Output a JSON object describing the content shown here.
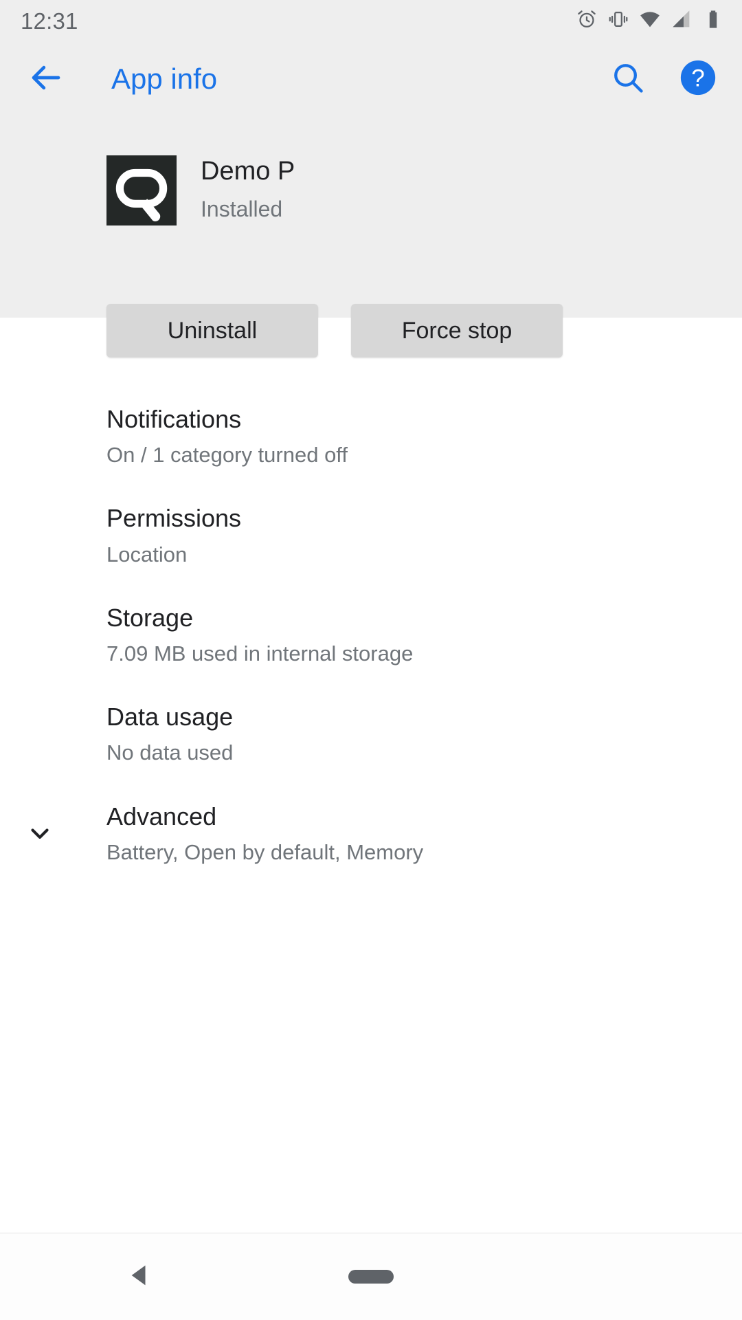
{
  "status_bar": {
    "time": "12:31",
    "icons": [
      "alarm-icon",
      "vibrate-icon",
      "wifi-icon",
      "cell-signal-icon",
      "battery-icon"
    ]
  },
  "app_bar": {
    "title": "App info",
    "back_icon": "arrow-back-icon",
    "search_icon": "search-icon",
    "help_icon": "help-icon",
    "accent_color": "#1a73e8"
  },
  "app_header": {
    "app_name": "Demo P",
    "install_state": "Installed",
    "icon_name": "demo-p-app-icon",
    "icon_background": "#242827",
    "icon_foreground": "#ffffff"
  },
  "actions": {
    "uninstall_label": "Uninstall",
    "force_stop_label": "Force stop",
    "button_color": "#d7d7d7"
  },
  "settings_rows": [
    {
      "name": "notifications",
      "title": "Notifications",
      "subtitle": "On / 1 category turned off",
      "leading_icon": ""
    },
    {
      "name": "permissions",
      "title": "Permissions",
      "subtitle": "Location",
      "leading_icon": ""
    },
    {
      "name": "storage",
      "title": "Storage",
      "subtitle": "7.09 MB used in internal storage",
      "leading_icon": ""
    },
    {
      "name": "data-usage",
      "title": "Data usage",
      "subtitle": "No data used",
      "leading_icon": ""
    },
    {
      "name": "advanced",
      "title": "Advanced",
      "subtitle": "Battery, Open by default, Memory",
      "leading_icon": "chevron-down-icon"
    }
  ],
  "bottom_nav": {
    "back_icon": "nav-back-triangle-icon",
    "home_icon": "nav-home-pill-icon"
  }
}
